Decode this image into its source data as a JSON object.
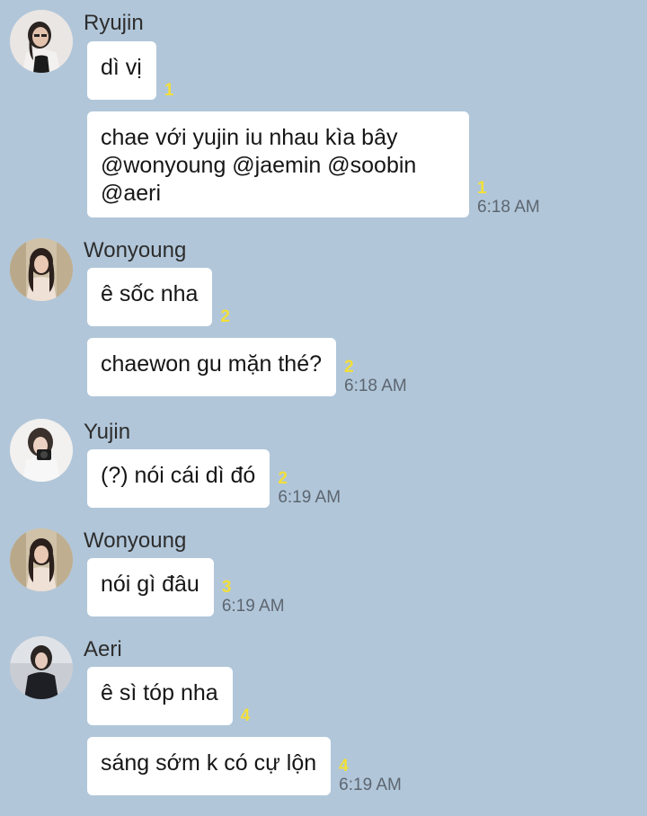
{
  "colors": {
    "background": "#b1c6d9",
    "bubble": "#ffffff",
    "unread": "#f2df3a",
    "time": "#5d6670"
  },
  "groups": [
    {
      "sender": "Ryujin",
      "avatar_icon": "ryujin-avatar",
      "messages": [
        {
          "text": "dì vị",
          "unread": "1",
          "time": ""
        },
        {
          "text": "chae với yujin iu nhau kìa bây\n@wonyoung @jaemin @soobin\n@aeri",
          "unread": "1",
          "time": "6:18 AM"
        }
      ]
    },
    {
      "sender": "Wonyoung",
      "avatar_icon": "wonyoung-avatar",
      "messages": [
        {
          "text": "ê sốc nha",
          "unread": "2",
          "time": ""
        },
        {
          "text": "chaewon gu mặn thé?",
          "unread": "2",
          "time": "6:18 AM"
        }
      ]
    },
    {
      "sender": "Yujin",
      "avatar_icon": "yujin-avatar",
      "messages": [
        {
          "text": "(?) nói cái dì đó",
          "unread": "2",
          "time": "6:19 AM"
        }
      ]
    },
    {
      "sender": "Wonyoung",
      "avatar_icon": "wonyoung-avatar",
      "messages": [
        {
          "text": "nói gì đâu",
          "unread": "3",
          "time": "6:19 AM"
        }
      ]
    },
    {
      "sender": "Aeri",
      "avatar_icon": "aeri-avatar",
      "messages": [
        {
          "text": "ê sì tóp nha",
          "unread": "4",
          "time": ""
        },
        {
          "text": "sáng sớm k có cự lộn",
          "unread": "4",
          "time": "6:19 AM"
        }
      ]
    }
  ]
}
